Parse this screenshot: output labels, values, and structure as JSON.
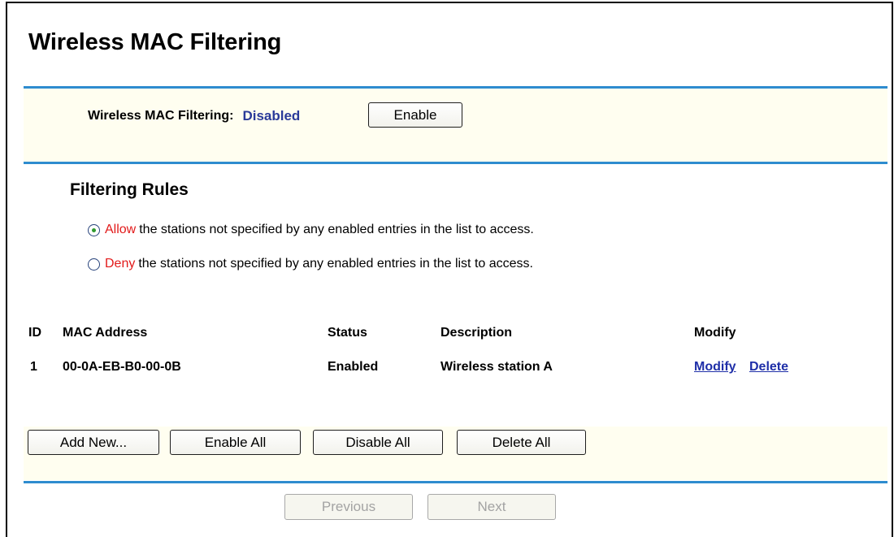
{
  "page": {
    "title": "Wireless MAC Filtering"
  },
  "filter_status": {
    "label": "Wireless MAC Filtering:",
    "value": "Disabled",
    "toggle_button": "Enable"
  },
  "rules": {
    "section_title": "Filtering Rules",
    "selected": "allow",
    "allow": {
      "keyword": "Allow",
      "text": "the stations not specified by any enabled entries in the list to access."
    },
    "deny": {
      "keyword": "Deny",
      "text": "the stations not specified by any enabled entries in the list to access."
    }
  },
  "table": {
    "headers": {
      "id": "ID",
      "mac": "MAC Address",
      "status": "Status",
      "description": "Description",
      "modify": "Modify"
    },
    "rows": [
      {
        "id": "1",
        "mac": "00-0A-EB-B0-00-0B",
        "status": "Enabled",
        "description": "Wireless station A",
        "modify_link": "Modify",
        "delete_link": "Delete"
      }
    ]
  },
  "actions": {
    "add_new": "Add New...",
    "enable_all": "Enable All",
    "disable_all": "Disable All",
    "delete_all": "Delete All"
  },
  "navigation": {
    "previous": "Previous",
    "next": "Next"
  },
  "colors": {
    "rule_line": "#2e8ccf",
    "band_background": "#fffef0",
    "status_value": "#2a3a99",
    "keyword": "#e21a1a",
    "link": "#1f2fa8"
  }
}
